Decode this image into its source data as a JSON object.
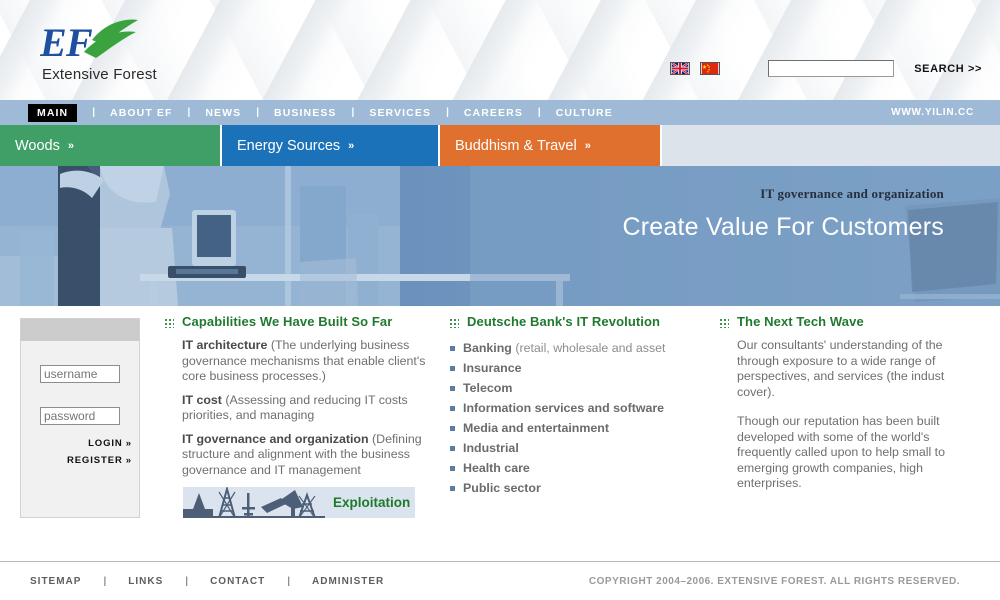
{
  "header": {
    "logo_initials": "EF",
    "company_name": "Extensive Forest",
    "flags": [
      {
        "name": "uk-flag",
        "title": "English"
      },
      {
        "name": "china-flag",
        "title": "中文"
      }
    ],
    "search": {
      "value": "",
      "placeholder": "",
      "label": "SEARCH >>"
    }
  },
  "nav": {
    "items": [
      {
        "label": "MAIN",
        "active": true
      },
      {
        "label": "ABOUT EF",
        "active": false
      },
      {
        "label": "NEWS",
        "active": false
      },
      {
        "label": "BUSINESS",
        "active": false
      },
      {
        "label": "SERVICES",
        "active": false
      },
      {
        "label": "CAREERS",
        "active": false
      },
      {
        "label": "CULTURE",
        "active": false
      }
    ],
    "separator": "|",
    "url": "WWW.YILIN.CC"
  },
  "categories": [
    {
      "label": "Woods",
      "chevron": "»",
      "color": "#3f9f67"
    },
    {
      "label": "Energy Sources",
      "chevron": "»",
      "color": "#1c72b8"
    },
    {
      "label": "Buddhism & Travel",
      "chevron": "»",
      "color": "#e0702e"
    }
  ],
  "hero": {
    "kicker": "IT governance and organization",
    "title": "Create Value For Customers"
  },
  "login": {
    "username_placeholder": "username",
    "username_value": "",
    "password_placeholder": "password",
    "password_value": "",
    "login_label": "LOGIN",
    "register_label": "REGISTER",
    "chevron": "»"
  },
  "columns": [
    {
      "title": "Capabilities We Have Built So Far",
      "items": [
        {
          "term": "IT architecture",
          "text": " (The underlying business governance mechanisms that enable client's core business processes.)"
        },
        {
          "term": "IT cost",
          "text": " (Assessing and reducing IT costs priorities, and managing"
        },
        {
          "term": "IT governance and organization",
          "text": " (Defining structure and alignment with the business governance and IT management"
        }
      ]
    },
    {
      "title": "Deutsche Bank's IT Revolution",
      "bullets": [
        {
          "strong": "Banking",
          "soft": " (retail, wholesale and asset"
        },
        {
          "strong": "Insurance",
          "soft": ""
        },
        {
          "strong": "Telecom",
          "soft": ""
        },
        {
          "strong": "Information services and software",
          "soft": ""
        },
        {
          "strong": "Media and entertainment",
          "soft": ""
        },
        {
          "strong": "Industrial",
          "soft": ""
        },
        {
          "strong": "Health care",
          "soft": ""
        },
        {
          "strong": "Public sector",
          "soft": ""
        }
      ]
    },
    {
      "title": "The Next Tech Wave",
      "paragraphs": [
        "Our consultants' understanding of the through exposure to a wide range of perspectives, and services (the indust cover).",
        "Though our reputation has been built developed with some of the world's frequently called upon to help small to emerging growth companies, high enterprises."
      ]
    }
  ],
  "promo": {
    "label": "Exploitation"
  },
  "footer": {
    "links": [
      "SITEMAP",
      "LINKS",
      "CONTACT",
      "ADMINISTER"
    ],
    "separator": "|",
    "copyright": "COPYRIGHT 2004–2006. EXTENSIVE FOREST. ALL RIGHTS RESERVED."
  }
}
